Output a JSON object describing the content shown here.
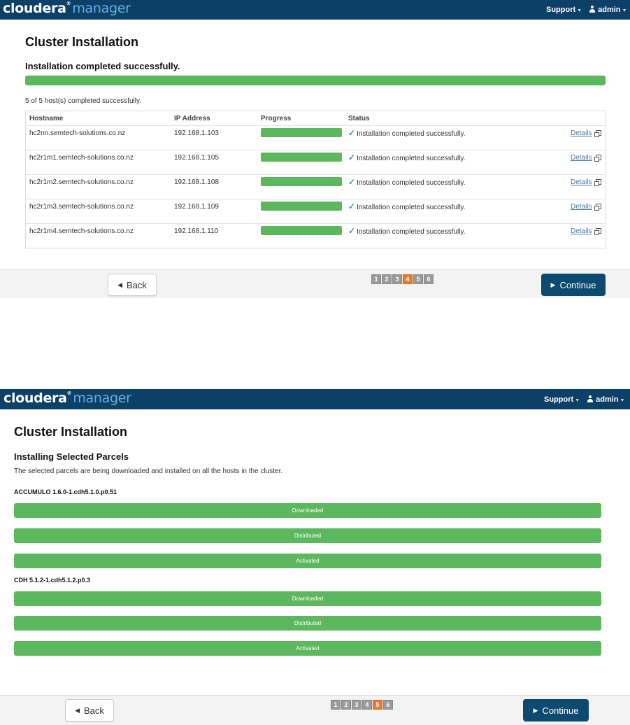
{
  "app": {
    "logo_word": "cloudera",
    "logo_reg": "®",
    "logo_product": "manager",
    "support_label": "Support",
    "user_label": "admin"
  },
  "screen1": {
    "title": "Cluster Installation",
    "subtitle": "Installation completed successfully.",
    "overall_progress": 1.0,
    "summary": "5 of 5 host(s) completed successfully.",
    "columns": [
      "Hostname",
      "IP Address",
      "Progress",
      "Status"
    ],
    "rows": [
      {
        "hostname": "hc2nn.semtech-solutions.co.nz",
        "ip": "192.168.1.103",
        "progress": 1.0,
        "status": "Installation completed successfully.",
        "details": "Details"
      },
      {
        "hostname": "hc2r1m1.semtech-solutions.co.nz",
        "ip": "192.168.1.105",
        "progress": 1.0,
        "status": "Installation completed successfully.",
        "details": "Details"
      },
      {
        "hostname": "hc2r1m2.semtech-solutions.co.nz",
        "ip": "192.168.1.108",
        "progress": 1.0,
        "status": "Installation completed successfully.",
        "details": "Details"
      },
      {
        "hostname": "hc2r1m3.semtech-solutions.co.nz",
        "ip": "192.168.1.109",
        "progress": 1.0,
        "status": "Installation completed successfully.",
        "details": "Details"
      },
      {
        "hostname": "hc2r1m4.semtech-solutions.co.nz",
        "ip": "192.168.1.110",
        "progress": 1.0,
        "status": "Installation completed successfully.",
        "details": "Details"
      }
    ],
    "back_label": "Back",
    "continue_label": "Continue",
    "pages": [
      "1",
      "2",
      "3",
      "4",
      "5",
      "6"
    ],
    "active_page": "4"
  },
  "screen2": {
    "title": "Cluster Installation",
    "subtitle": "Installing Selected Parcels",
    "description": "The selected parcels are being downloaded and installed on all the hosts in the cluster.",
    "parcels": [
      {
        "name": "ACCUMULO 1.6.0-1.cdh5.1.0.p0.51",
        "stages": [
          "Downloaded",
          "Distributed",
          "Activated"
        ]
      },
      {
        "name": "CDH 5.1.2-1.cdh5.1.2.p0.3",
        "stages": [
          "Downloaded",
          "Distributed",
          "Activated"
        ]
      }
    ],
    "back_label": "Back",
    "continue_label": "Continue",
    "pages": [
      "1",
      "2",
      "3",
      "4",
      "5",
      "6"
    ],
    "active_page": "5"
  },
  "colors": {
    "navbar": "#0c4067",
    "progress": "#5cb85c",
    "active_page": "#e87a2d",
    "continue_button": "#0d4a6f"
  }
}
